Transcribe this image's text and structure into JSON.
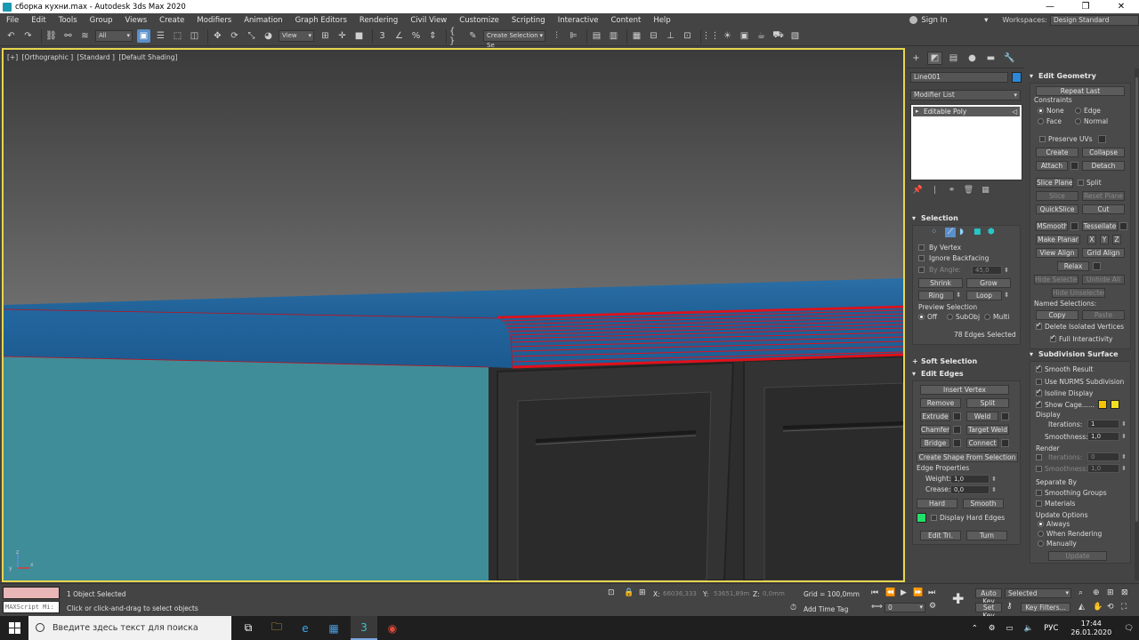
{
  "window": {
    "title": "сборка кухни.max - Autodesk 3ds Max 2020",
    "controls": [
      "—",
      "❐",
      "✕"
    ]
  },
  "menu": {
    "items": [
      "File",
      "Edit",
      "Tools",
      "Group",
      "Views",
      "Create",
      "Modifiers",
      "Animation",
      "Graph Editors",
      "Rendering",
      "Civil View",
      "Customize",
      "Scripting",
      "Interactive",
      "Content",
      "Help"
    ],
    "sign_in": "Sign In",
    "workspaces_label": "Workspaces:",
    "workspace": "Design Standard"
  },
  "toolbar": {
    "filter": "All",
    "ref_coord": "View",
    "selection_set_placeholder": "Create Selection Se"
  },
  "viewport": {
    "labels": [
      "[+]",
      "[Orthographic ]",
      "[Standard ]",
      "[Default Shading]"
    ]
  },
  "command_panel": {
    "object_name": "Line001",
    "object_color": "#2d88d9",
    "modifier_list": "Modifier List",
    "stack_entry": "Editable Poly",
    "selection": {
      "title": "Selection",
      "by_vertex": "By Vertex",
      "ignore_backfacing": "Ignore Backfacing",
      "by_angle": "By Angle:",
      "by_angle_value": "45,0",
      "shrink": "Shrink",
      "grow": "Grow",
      "ring": "Ring",
      "loop": "Loop",
      "preview_selection": "Preview Selection",
      "preview_off": "Off",
      "preview_subobj": "SubObj",
      "preview_multi": "Multi",
      "status": "78 Edges Selected"
    },
    "soft_selection": "Soft Selection",
    "edit_edges": {
      "title": "Edit Edges",
      "insert_vertex": "Insert Vertex",
      "remove": "Remove",
      "split": "Split",
      "extrude": "Extrude",
      "weld": "Weld",
      "chamfer": "Chamfer",
      "target_weld": "Target Weld",
      "bridge": "Bridge",
      "connect": "Connect",
      "create_shape": "Create Shape From Selection",
      "edge_properties": "Edge Properties",
      "weight_label": "Weight:",
      "weight": "1,0",
      "crease_label": "Crease:",
      "crease": "0,0",
      "hard": "Hard",
      "smooth": "Smooth",
      "hard_edges_color": "#22e06a",
      "display_hard_edges": "Display Hard Edges",
      "edit_tri": "Edit Tri.",
      "turn": "Turn"
    }
  },
  "edit_geometry": {
    "title": "Edit Geometry",
    "repeat_last": "Repeat Last",
    "constraints": "Constraints",
    "none": "None",
    "edge": "Edge",
    "face": "Face",
    "normal": "Normal",
    "preserve_uvs": "Preserve UVs",
    "create": "Create",
    "collapse": "Collapse",
    "attach": "Attach",
    "detach": "Detach",
    "slice_plane": "Slice Plane",
    "split": "Split",
    "slice": "Slice",
    "reset_plane": "Reset Plane",
    "quickslice": "QuickSlice",
    "cut": "Cut",
    "msmooth": "MSmooth",
    "tessellate": "Tessellate",
    "make_planar": "Make Planar",
    "x": "X",
    "y": "Y",
    "z": "Z",
    "view_align": "View Align",
    "grid_align": "Grid Align",
    "relax": "Relax",
    "hide_selected": "Hide Selected",
    "unhide_all": "Unhide All",
    "hide_unselected": "Hide Unselected",
    "named_selections": "Named Selections:",
    "copy": "Copy",
    "paste": "Paste",
    "delete_isolated": "Delete Isolated Vertices",
    "full_interactivity": "Full Interactivity"
  },
  "subdivision": {
    "title": "Subdivision Surface",
    "smooth_result": "Smooth Result",
    "use_nurms": "Use NURMS Subdivision",
    "isoline_display": "Isoline Display",
    "show_cage": "Show Cage......",
    "cage_color_1": "#f5c400",
    "cage_color_2": "#f0e020",
    "display": "Display",
    "iterations_label": "Iterations:",
    "iterations": "1",
    "smoothness_label": "Smoothness:",
    "smoothness": "1,0",
    "render": "Render",
    "r_iterations_label": "Iterations:",
    "r_iterations": "0",
    "r_smoothness_label": "Smoothness:",
    "r_smoothness": "1,0",
    "separate_by": "Separate By",
    "smoothing_groups": "Smoothing Groups",
    "materials": "Materials",
    "update_options": "Update Options",
    "always": "Always",
    "when_rendering": "When Rendering",
    "manually": "Manually",
    "update": "Update"
  },
  "status": {
    "maxscript": "MAXScript Mi:",
    "selected": "1 Object Selected",
    "hint": "Click or click-and-drag to select objects",
    "x_label": "X:",
    "x": "66036,333",
    "y_label": "Y:",
    "y": "53651,89m",
    "z_label": "Z:",
    "z": "0,0mm",
    "grid": "Grid = 100,0mm",
    "add_time_tag": "Add Time Tag",
    "frame": "0",
    "auto_key": "Auto Key",
    "set_key": "Set Key",
    "key_mode": "Selected",
    "key_filters": "Key Filters..."
  },
  "taskbar": {
    "search": "Введите здесь текст для поиска",
    "lang": "РУС",
    "time": "17:44",
    "date": "26.01.2020"
  }
}
